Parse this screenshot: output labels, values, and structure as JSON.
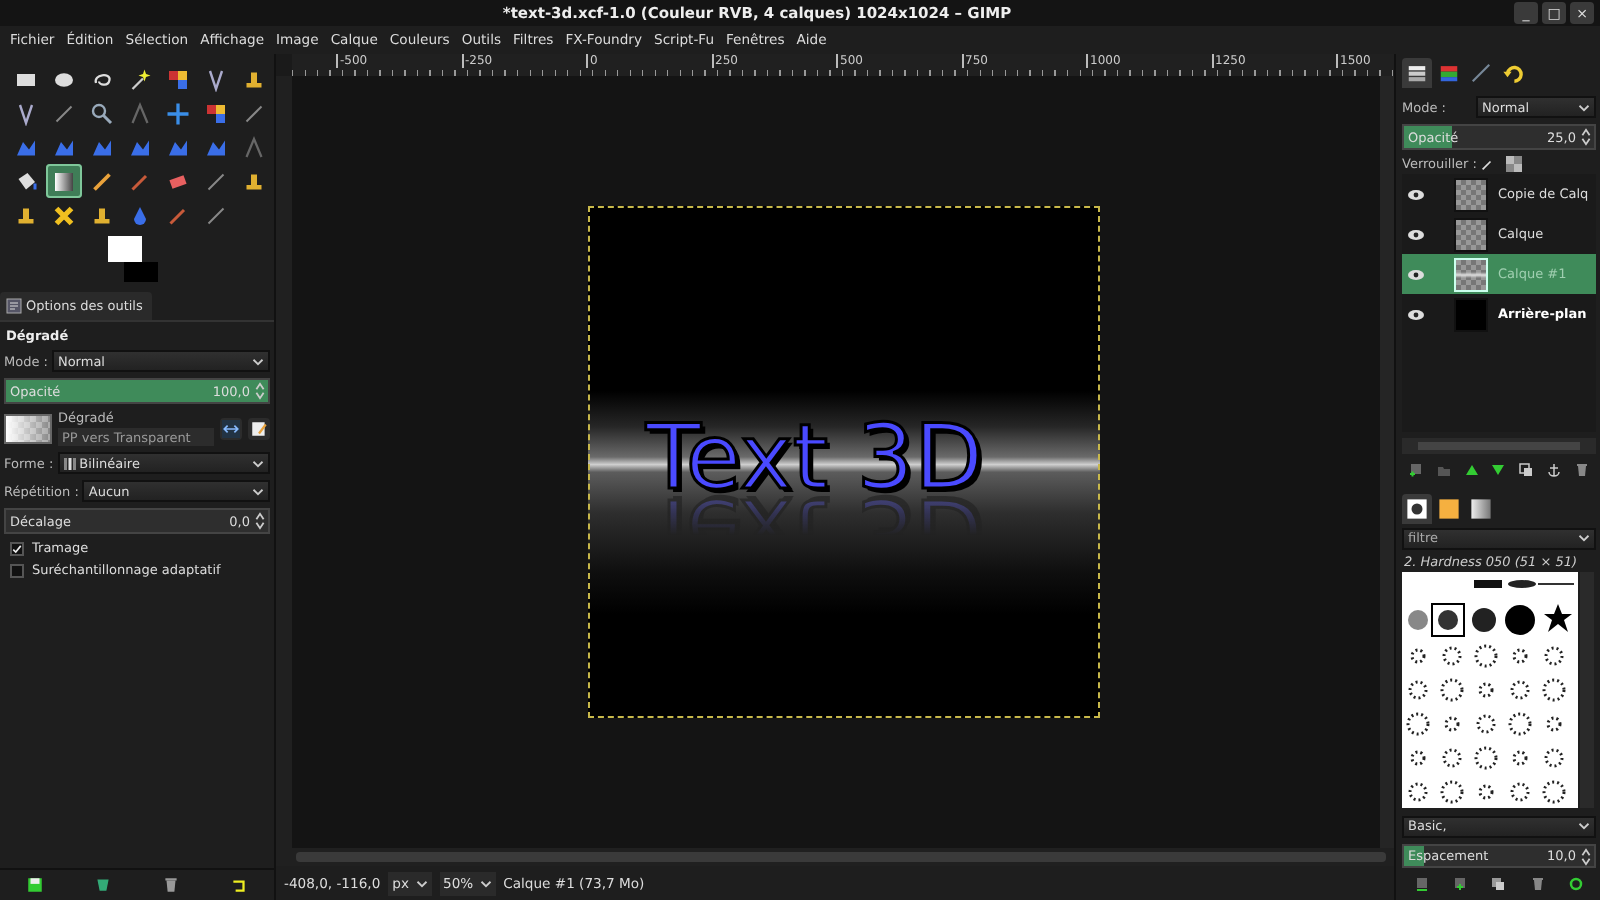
{
  "window": {
    "title": "*text-3d.xcf-1.0 (Couleur RVB, 4 calques) 1024x1024 – GIMP",
    "controls": [
      "_",
      "□",
      "×"
    ]
  },
  "menu": [
    "Fichier",
    "Édition",
    "Sélection",
    "Affichage",
    "Image",
    "Calque",
    "Couleurs",
    "Outils",
    "Filtres",
    "FX-Foundry",
    "Script-Fu",
    "Fenêtres",
    "Aide"
  ],
  "toolbox": {
    "tools": [
      {
        "selected": false
      },
      {
        "selected": false
      },
      {
        "selected": false
      },
      {
        "selected": false
      },
      {
        "selected": false
      },
      {
        "selected": false
      },
      {
        "selected": false
      },
      {
        "selected": false
      },
      {
        "selected": false
      },
      {
        "selected": false
      },
      {
        "selected": false
      },
      {
        "selected": false
      },
      {
        "selected": false
      },
      {
        "selected": false
      },
      {
        "selected": false
      },
      {
        "selected": false
      },
      {
        "selected": false
      },
      {
        "selected": false
      },
      {
        "selected": false
      },
      {
        "selected": false
      },
      {
        "selected": false
      },
      {
        "selected": false
      },
      {
        "selected": true
      },
      {
        "selected": false
      },
      {
        "selected": false
      },
      {
        "selected": false
      },
      {
        "selected": false
      },
      {
        "selected": false
      },
      {
        "selected": false
      },
      {
        "selected": false
      },
      {
        "selected": false
      },
      {
        "selected": false
      },
      {
        "selected": false
      },
      {
        "selected": false
      }
    ],
    "swatches": [
      {
        "color": "#ffffff"
      },
      {
        "color": "#000000"
      }
    ]
  },
  "tool_options": {
    "tab": "Options des outils",
    "tool": "Dégradé",
    "mode": {
      "label": "Mode :",
      "value": "Normal"
    },
    "opacity": {
      "label": "Opacité",
      "reading": "100,0",
      "level": 1
    },
    "gradient": {
      "label": "Dégradé",
      "value": "PP vers Transparent"
    },
    "shape": {
      "label": "Forme :",
      "value": "Bilinéaire"
    },
    "repeat": {
      "label": "Répétition :",
      "value": "Aucun"
    },
    "offset": {
      "label": "Décalage",
      "reading": "0,0",
      "level": 0
    },
    "checks": [
      {
        "label": "Tramage",
        "checked": true
      },
      {
        "label": "Suréchantillonnage adaptatif",
        "checked": false
      }
    ]
  },
  "canvas": {
    "ruler_labels": [
      "-500",
      "-250",
      "0",
      "250",
      "500",
      "750",
      "1000",
      "1250",
      "1500"
    ],
    "text": "Text 3D"
  },
  "status_bar": {
    "coordinates": "-408,0, -116,0",
    "unit": "px",
    "zoom": "50%",
    "info": "Calque #1 (73,7 Mo)"
  },
  "layers": {
    "tabs": [
      {
        "selected": true
      },
      {
        "selected": false
      },
      {
        "selected": false
      },
      {
        "selected": false
      }
    ],
    "mode": {
      "label": "Mode :",
      "value": "Normal"
    },
    "opacity": {
      "label": "Opacité",
      "reading": "25,0",
      "level": 0.25
    },
    "lock_label": "Verrouiller :",
    "items": [
      {
        "name": "Copie de Calq",
        "visible": true,
        "selected": false,
        "bold": false,
        "kind": "transparent"
      },
      {
        "name": "Calque",
        "visible": true,
        "selected": false,
        "bold": false,
        "kind": "transparent"
      },
      {
        "name": "Calque #1",
        "visible": true,
        "selected": true,
        "bold": false,
        "kind": "band"
      },
      {
        "name": "Arrière-plan",
        "visible": true,
        "selected": false,
        "bold": true,
        "kind": "black"
      }
    ]
  },
  "brushes": {
    "tabs": [
      {
        "selected": true
      },
      {
        "selected": false
      },
      {
        "selected": false
      }
    ],
    "filter_placeholder": "filtre",
    "name": "2. Hardness 050 (51 × 51)",
    "tag": "Basic,",
    "spacing": {
      "label": "Espacement",
      "reading": "10,0",
      "level": 0.1
    }
  }
}
